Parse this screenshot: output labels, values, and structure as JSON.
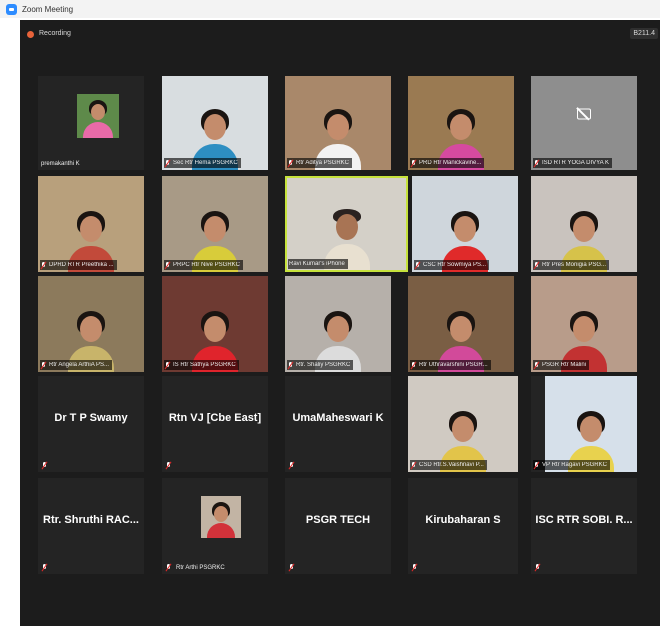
{
  "window": {
    "title": "Zoom Meeting"
  },
  "meeting": {
    "recording_label": "Recording",
    "view_label": "B211.4"
  },
  "participants": {
    "p1": {
      "name": "premakanthi K",
      "muted": false
    },
    "p2": {
      "name": "Sec Rtr Hema PSGRKC",
      "muted": true
    },
    "p3": {
      "name": "Rtr Aditya PSGRKC",
      "muted": true
    },
    "p4": {
      "name": "PRD Rtr Manickavine...",
      "muted": true
    },
    "p5": {
      "name": "ISD RTR YOGA DIVYA K",
      "muted": true
    },
    "p6": {
      "name": "DPRD RTR Preethika ...",
      "muted": true
    },
    "p7": {
      "name": "PRPC Rtr Nive PSGRKC",
      "muted": true
    },
    "p8": {
      "name": "Ravi Kumar's iPhone",
      "muted": false
    },
    "p9": {
      "name": "CSC Rtr Sowmiya PS...",
      "muted": true
    },
    "p10": {
      "name": "Rtr Pres Monigia PSG...",
      "muted": true
    },
    "p11": {
      "name": "Rtr Angela ArthiA PS...",
      "muted": true
    },
    "p12": {
      "name": "IS Rtr Sathya PSGRKC",
      "muted": true
    },
    "p13": {
      "name": "Rtr. Shaliy PSGRKC",
      "muted": true
    },
    "p14": {
      "name": "Rtr Uthravarshini PSGR...",
      "muted": true
    },
    "p15": {
      "name": "PSGR Rtr Malini",
      "muted": true
    },
    "p16": {
      "name": "Dr T P Swamy",
      "muted": true
    },
    "p17": {
      "name": "Rtn VJ [Cbe East]",
      "muted": true
    },
    "p18": {
      "name": "UmaMaheswari K",
      "muted": true
    },
    "p19": {
      "name": "CSD Rtr.S.Vaishnavi P...",
      "muted": true
    },
    "p20": {
      "name": "VP Rtr Ragavi PSGRKC",
      "muted": true
    },
    "p21": {
      "name": "Rtr. Shruthi RAC...",
      "muted": true
    },
    "p22": {
      "name": "Rtr Arthi PSGRKC",
      "muted": true
    },
    "p23": {
      "name": "PSGR TECH",
      "muted": true
    },
    "p24": {
      "name": "Kirubaharan S",
      "muted": true
    },
    "p25": {
      "name": "ISC RTR SOBI. R...",
      "muted": true
    }
  },
  "colors": {
    "active_speaker": "#c6e23c",
    "recording": "#e8633a",
    "muted_mic": "#e02828"
  }
}
